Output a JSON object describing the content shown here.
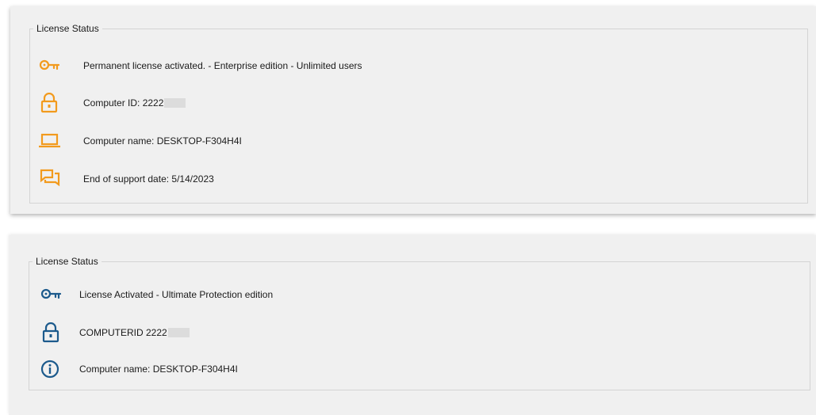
{
  "top_panel": {
    "group_title": "License Status",
    "accent_color": "#f29a1d",
    "rows": [
      {
        "icon": "key-icon",
        "text": "Permanent license activated. - Enterprise edition - Unlimited users"
      },
      {
        "icon": "lock-icon",
        "text": "Computer ID: 2222",
        "redacted_suffix": true
      },
      {
        "icon": "laptop-icon",
        "text": "Computer name: DESKTOP-F304H4I"
      },
      {
        "icon": "chat-icon",
        "text": "End of support date: 5/14/2023"
      }
    ]
  },
  "bottom_panel": {
    "group_title": "License Status",
    "accent_color": "#1c5a8c",
    "rows": [
      {
        "icon": "key-icon",
        "text": "License Activated - Ultimate Protection edition"
      },
      {
        "icon": "lock-icon",
        "text": "COMPUTERID 2222",
        "redacted_suffix": true
      },
      {
        "icon": "info-icon",
        "text": "Computer name: DESKTOP-F304H4I"
      }
    ]
  }
}
